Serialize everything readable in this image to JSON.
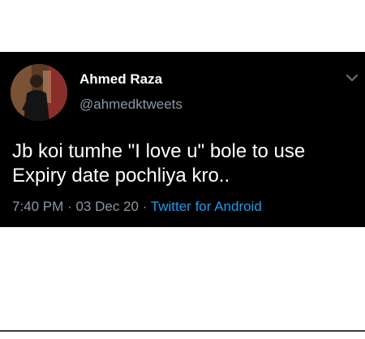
{
  "tweet": {
    "author": {
      "display_name": "Ahmed Raza",
      "handle": "@ahmedktweets"
    },
    "text_line_1": "Jb koi tumhe \"I love u\" bole to use",
    "text_line_2": "Expiry date pochliya kro..",
    "time": "7:40 PM",
    "date": "03 Dec 20",
    "separator": "·",
    "source": "Twitter for Android"
  },
  "colors": {
    "background": "#000000",
    "text": "#ffffff",
    "muted": "#8b98a5",
    "link": "#1d9bf0"
  },
  "icons": {
    "menu": "chevron-down-icon"
  }
}
